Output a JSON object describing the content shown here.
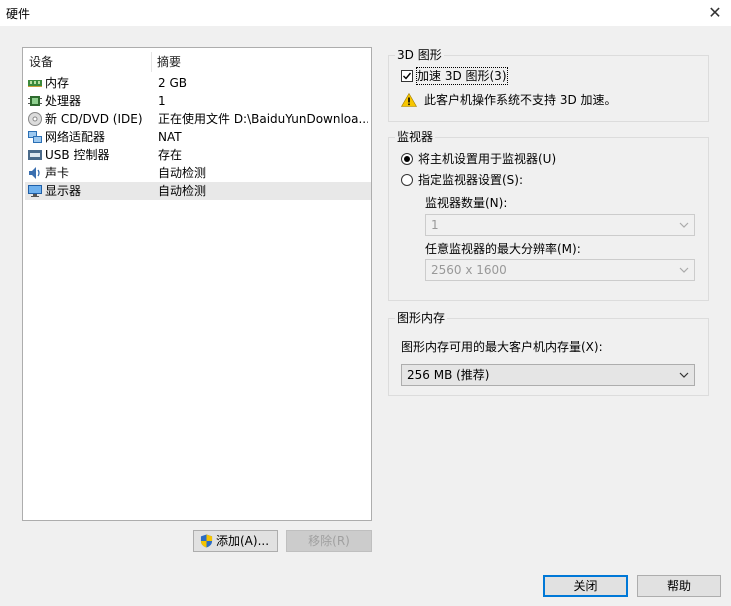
{
  "window": {
    "title": "硬件",
    "close_symbol": "✕"
  },
  "device_list": {
    "columns": {
      "device": "设备",
      "summary": "摘要"
    },
    "rows": [
      {
        "name": "内存",
        "summary": "2 GB",
        "icon": "memory-icon"
      },
      {
        "name": "处理器",
        "summary": "1",
        "icon": "processor-icon"
      },
      {
        "name": "新 CD/DVD (IDE)",
        "summary": "正在使用文件 D:\\BaiduYunDownloa...",
        "icon": "cd-dvd-icon"
      },
      {
        "name": "网络适配器",
        "summary": "NAT",
        "icon": "network-adapter-icon"
      },
      {
        "name": "USB 控制器",
        "summary": "存在",
        "icon": "usb-icon"
      },
      {
        "name": "声卡",
        "summary": "自动检测",
        "icon": "sound-card-icon"
      },
      {
        "name": "显示器",
        "summary": "自动检测",
        "icon": "display-icon",
        "selected": true
      }
    ]
  },
  "buttons": {
    "add": "添加(A)...",
    "remove": "移除(R)",
    "close": "关闭",
    "help": "帮助"
  },
  "graphics3d": {
    "group_label": "3D 图形",
    "accelerate_label": "加速 3D 图形(3)",
    "accelerate_checked": true,
    "warning": "此客户机操作系统不支持 3D 加速。"
  },
  "monitor": {
    "group_label": "监视器",
    "option_host": "将主机设置用于监视器(U)",
    "option_custom": "指定监视器设置(S):",
    "selected_option": "host",
    "count_label": "监视器数量(N):",
    "count_value": "1",
    "max_res_label": "任意监视器的最大分辨率(M):",
    "max_res_value": "2560 x 1600"
  },
  "graphics_memory": {
    "group_label": "图形内存",
    "label": "图形内存可用的最大客户机内存量(X):",
    "value": "256 MB (推荐)"
  },
  "colors": {
    "accent": "#0078d7",
    "selection": "#e8e8e8",
    "warning": "#f7c600"
  }
}
